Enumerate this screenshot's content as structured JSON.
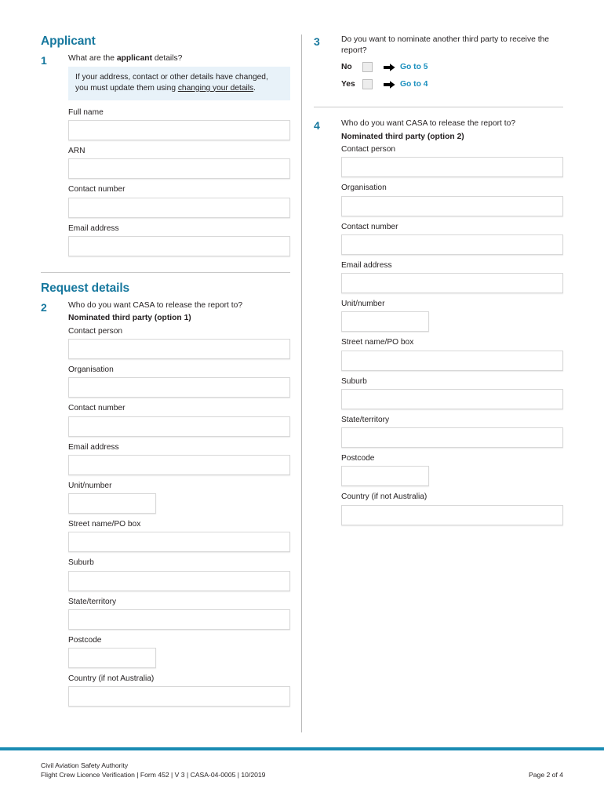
{
  "document": {
    "form_title": "Flight Crew Licence Verification",
    "page_label": "Page 2 of 4"
  },
  "colors": {
    "accent_teal": "#17789e",
    "link_blue": "#1a8fbe",
    "footer_rule": "#1a8bb3",
    "callout_bg": "#e8f2f9"
  },
  "left_column": {
    "section1": {
      "title": "Applicant",
      "question": {
        "number": "1",
        "text_before": "What are the ",
        "text_bold": "applicant",
        "text_after": " details?"
      },
      "callout": {
        "text_before": "If your address, contact or other details have changed, you must update them using ",
        "link_text": "changing your details",
        "text_after": "."
      },
      "fields": [
        {
          "label": "Full name",
          "value": "",
          "width": "full"
        },
        {
          "label": "ARN",
          "value": "",
          "width": "full"
        },
        {
          "label": "Contact number",
          "value": "",
          "width": "full"
        },
        {
          "label": "Email address",
          "value": "",
          "width": "full"
        }
      ]
    },
    "section2": {
      "title": "Request details",
      "question": {
        "number": "2",
        "text": "Who do you want CASA to release the report to?",
        "subheading": "Nominated third party (option 1)"
      },
      "fields": [
        {
          "label": "Contact person",
          "value": "",
          "width": "full"
        },
        {
          "label": "Organisation",
          "value": "",
          "width": "full"
        },
        {
          "label": "Contact number",
          "value": "",
          "width": "full"
        },
        {
          "label": "Email address",
          "value": "",
          "width": "full"
        },
        {
          "label": "Unit/number",
          "value": "",
          "width": "narrow"
        },
        {
          "label": "Street name/PO box",
          "value": "",
          "width": "full"
        },
        {
          "label": "Suburb",
          "value": "",
          "width": "full"
        },
        {
          "label": "State/territory",
          "value": "",
          "width": "full"
        },
        {
          "label": "Postcode",
          "value": "",
          "width": "narrow"
        },
        {
          "label": "Country (if not Australia)",
          "value": "",
          "width": "full"
        }
      ]
    }
  },
  "right_column": {
    "question3": {
      "number": "3",
      "text": "Do you want to nominate another third party to receive the report?",
      "options": [
        {
          "label": "No",
          "checked": false,
          "goto": "Go to 5"
        },
        {
          "label": "Yes",
          "checked": false,
          "goto": "Go to 4"
        }
      ]
    },
    "question4": {
      "number": "4",
      "text": "Who do you want CASA to release the report to?",
      "subheading": "Nominated third party (option 2)",
      "fields": [
        {
          "label": "Contact person",
          "value": "",
          "width": "full"
        },
        {
          "label": "Organisation",
          "value": "",
          "width": "full"
        },
        {
          "label": "Contact number",
          "value": "",
          "width": "full"
        },
        {
          "label": "Email address",
          "value": "",
          "width": "full"
        },
        {
          "label": "Unit/number",
          "value": "",
          "width": "narrow"
        },
        {
          "label": "Street name/PO box",
          "value": "",
          "width": "full"
        },
        {
          "label": "Suburb",
          "value": "",
          "width": "full"
        },
        {
          "label": "State/territory",
          "value": "",
          "width": "full"
        },
        {
          "label": "Postcode",
          "value": "",
          "width": "narrow"
        },
        {
          "label": "Country (if not Australia)",
          "value": "",
          "width": "full"
        }
      ]
    }
  },
  "footer": {
    "line1": "Civil Aviation Safety Authority",
    "line2": "Flight Crew Licence Verification | Form 452 | V 3 | CASA-04-0005 | 10/2019",
    "page": "Page 2 of 4"
  }
}
